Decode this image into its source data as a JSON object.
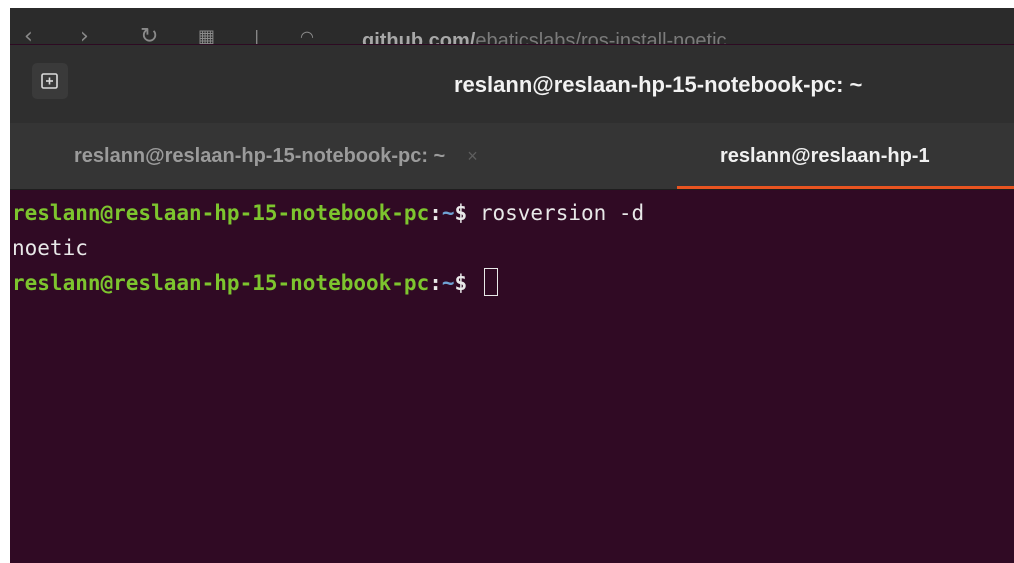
{
  "browser": {
    "url": "github.com/",
    "url_rest": "ebaticslabs/ros-install-noetic"
  },
  "window": {
    "title": "reslann@reslaan-hp-15-notebook-pc: ~"
  },
  "tabs": [
    {
      "label": "reslann@reslaan-hp-15-notebook-pc: ~",
      "close": "×"
    },
    {
      "label": "reslann@reslaan-hp-1"
    }
  ],
  "terminal": {
    "prompt_user": "reslann@reslaan-hp-15-notebook-pc",
    "prompt_sep": ":",
    "prompt_path": "~",
    "prompt_symbol": "$ ",
    "command": "rosversion -d",
    "output": "noetic"
  },
  "colors": {
    "terminal_bg": "#300a24",
    "prompt_user": "#7dc52e",
    "prompt_path": "#6fa3d4",
    "accent": "#e95420"
  }
}
